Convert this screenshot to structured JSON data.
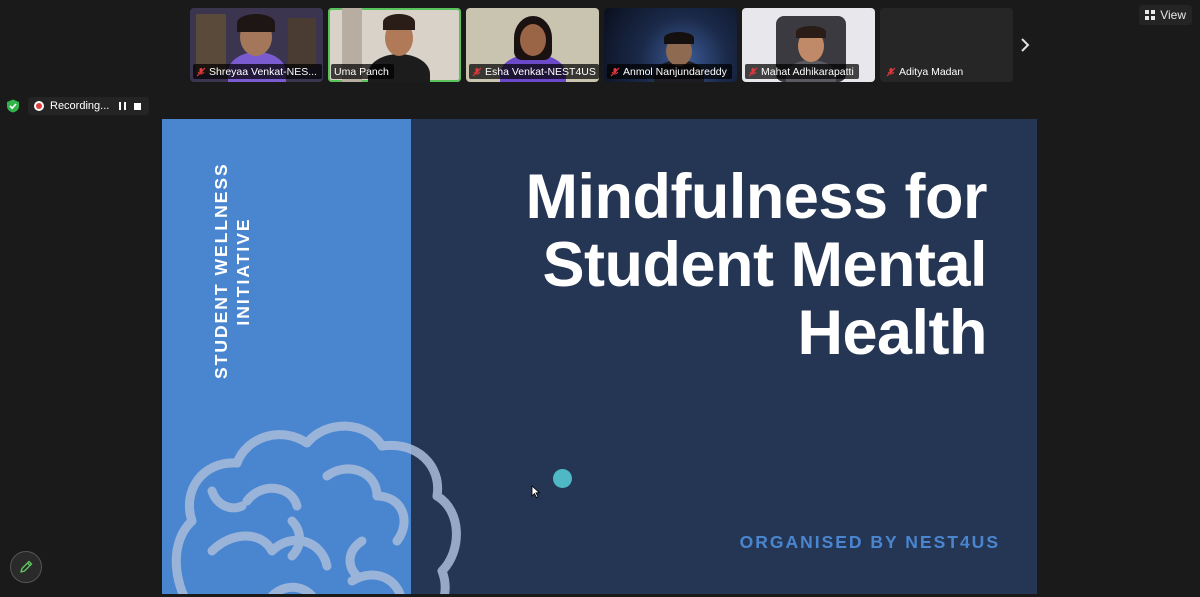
{
  "top_bar": {
    "view_label": "View"
  },
  "participants": [
    {
      "name": "Shreyaa Venkat-NES...",
      "muted": true,
      "active": false,
      "bg": "#3b3550"
    },
    {
      "name": "Uma Panch",
      "muted": false,
      "active": true,
      "bg": "#d8d2c8"
    },
    {
      "name": "Esha Venkat-NEST4US",
      "muted": true,
      "active": false,
      "bg": "#c9c4b0"
    },
    {
      "name": "Anmol Nanjundareddy",
      "muted": true,
      "active": false,
      "bg": "#1b2a4a"
    },
    {
      "name": "Mahat Adhikarapatti",
      "muted": true,
      "active": false,
      "bg": "#e8e8ec"
    },
    {
      "name": "Aditya Madan",
      "muted": true,
      "active": false,
      "bg": "#262626"
    }
  ],
  "status": {
    "recording_label": "Recording..."
  },
  "slide": {
    "side_text_line1": "STUDENT WELLNESS",
    "side_text_line2": "INITIATIVE",
    "title_line1": "Mindfulness for",
    "title_line2": "Student Mental",
    "title_line3": "Health",
    "organiser": "ORGANISED BY NEST4US"
  },
  "colors": {
    "slide_bg": "#253655",
    "slide_accent": "#4a86d0",
    "active_speaker": "#57c35a",
    "recording": "#e0393e",
    "teal_dot": "#4fb8c4"
  },
  "icons": [
    "grid-icon",
    "muted-mic-icon",
    "chevron-right-icon",
    "shield-check-icon",
    "record-icon",
    "pause-icon",
    "stop-icon",
    "pencil-icon",
    "mouse-cursor-icon",
    "brain-icon"
  ]
}
